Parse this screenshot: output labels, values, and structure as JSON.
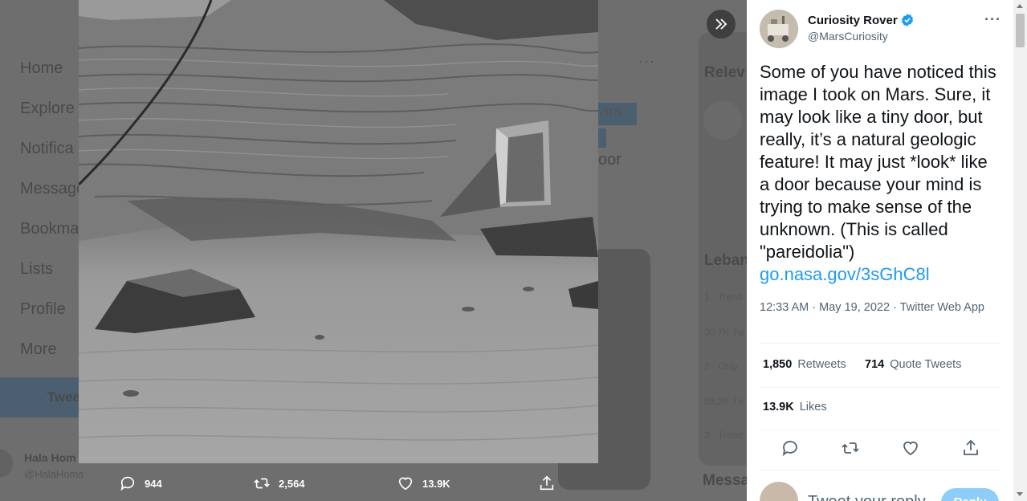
{
  "background": {
    "nav_items": [
      "Home",
      "Explore",
      "Notifica",
      "Message",
      "Bookma",
      "Lists",
      "Profile",
      "More"
    ],
    "tweet_button": "Twee",
    "account_name": "Hala Hom",
    "account_handle": "@HalaHoms",
    "mid_keyword": "ars.",
    "mid_text": "oor",
    "right_heading_1": "Relev",
    "right_heading_2": "Leban",
    "right_heading_3": "Messa",
    "trend_lines": [
      "1 · Trend",
      "30.7K Tw",
      "2 · Only",
      "58.2K Tw",
      "3 · Trend"
    ]
  },
  "media_bar": {
    "replies": "944",
    "retweets": "2,564",
    "likes": "13.9K"
  },
  "tweet": {
    "author_name": "Curiosity Rover",
    "author_handle": "@MarsCuriosity",
    "text": "Some of you have noticed this image I took on Mars. Sure, it may look like a tiny door, but really, it’s a natural geologic feature! It may just *look* like a door because your mind is trying to make sense of the unknown. (This is called \"pareidolia\")",
    "link": "go.nasa.gov/3sGhC8l",
    "time": "12:33 AM",
    "date": "May 19, 2022",
    "source": "Twitter Web App",
    "retweets_count": "1,850",
    "retweets_label": "Retweets",
    "quote_count": "714",
    "quote_label": "Quote Tweets",
    "likes_count": "13.9K",
    "likes_label": "Likes",
    "reply_placeholder": "Tweet your reply",
    "reply_button": "Reply"
  },
  "colors": {
    "accent": "#1d9bf0",
    "verified": "#1d9bf0",
    "text_primary": "#0f1419",
    "text_secondary": "#536471"
  }
}
